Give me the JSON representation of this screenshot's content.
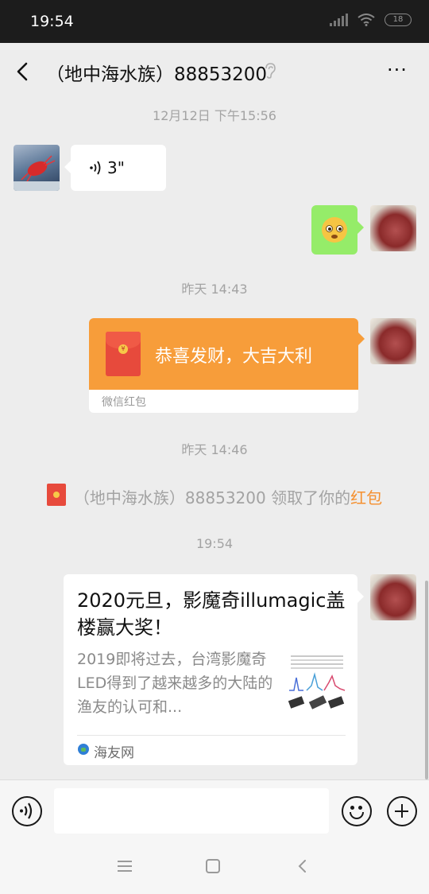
{
  "status_bar": {
    "time": "19:54",
    "battery": "18"
  },
  "header": {
    "title": "（地中海水族）88853200",
    "more_label": "···"
  },
  "messages": [
    {
      "type": "time",
      "text": "12月12日 下午15:56"
    },
    {
      "type": "voice",
      "from": "other",
      "duration": "3\""
    },
    {
      "type": "emoji",
      "from": "me",
      "emoji": "shocked-face"
    },
    {
      "type": "time",
      "text": "昨天 14:43"
    },
    {
      "type": "red_packet",
      "from": "me",
      "greeting": "恭喜发财，大吉大利",
      "label": "微信红包"
    },
    {
      "type": "time",
      "text": "昨天 14:46"
    },
    {
      "type": "system",
      "text": "（地中海水族）88853200 领取了你的",
      "link": "红包"
    },
    {
      "type": "time",
      "text": "19:54"
    },
    {
      "type": "link_card",
      "from": "me",
      "title": "2020元旦，影魔奇illumagic盖楼赢大奖！",
      "description": "2019即将过去，台湾影魔奇LED得到了越来越多的大陆的渔友的认可和...",
      "source": "海友网"
    }
  ],
  "input_bar": {
    "placeholder": ""
  },
  "colors": {
    "bubble_me": "#95ec69",
    "red_packet": "#f79d3a",
    "link_accent": "#f5902f",
    "background": "#ededed"
  }
}
